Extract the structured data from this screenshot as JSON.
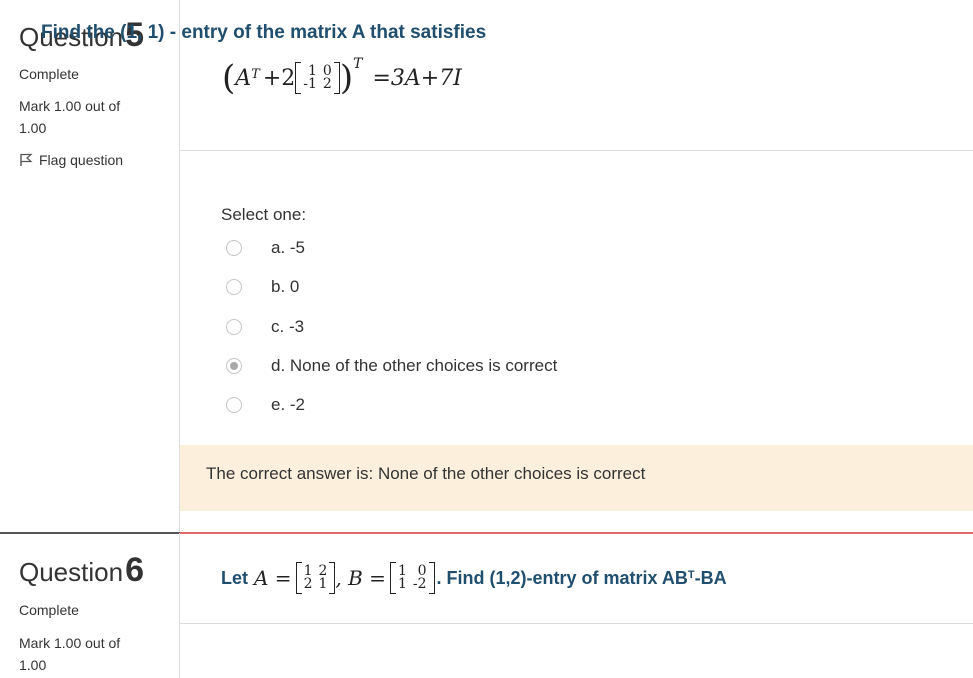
{
  "q5": {
    "word": "Question",
    "number": "5",
    "status": "Complete",
    "mark_line1": "Mark 1.00 out of",
    "mark_line2": "1.00",
    "flag": "Flag question",
    "question_text": "Find the (1, 1) - entry of the matrix A that satisfies",
    "equation": {
      "lhs_var": "A",
      "lhs_sup": "T",
      "plus": "+2",
      "matrix": [
        [
          "1",
          "0"
        ],
        [
          "-1",
          "2"
        ]
      ],
      "outer_sup": "T",
      "rhs": "=3A+7I"
    },
    "select_label": "Select one:",
    "options": [
      {
        "label": "a. -5",
        "checked": false
      },
      {
        "label": "b. 0",
        "checked": false
      },
      {
        "label": "c. -3",
        "checked": false
      },
      {
        "label": "d. None of the other choices is correct",
        "checked": true
      },
      {
        "label": "e. -2",
        "checked": false
      }
    ],
    "feedback": "The correct answer is: None of the other choices is correct"
  },
  "q6": {
    "word": "Question",
    "number": "6",
    "status": "Complete",
    "mark_line1": "Mark 1.00 out of",
    "mark_line2": "1.00",
    "let": "Let",
    "a_label": "A =",
    "a_matrix": [
      [
        "1",
        "2"
      ],
      [
        "2",
        "1"
      ]
    ],
    "b_label": ", B =",
    "b_matrix": [
      [
        "1",
        "0"
      ],
      [
        "1",
        "-2"
      ]
    ],
    "tail_prefix": ". Find (1,2)-entry of matrix AB",
    "tail_sup": "T",
    "tail_suffix": "-BA"
  }
}
